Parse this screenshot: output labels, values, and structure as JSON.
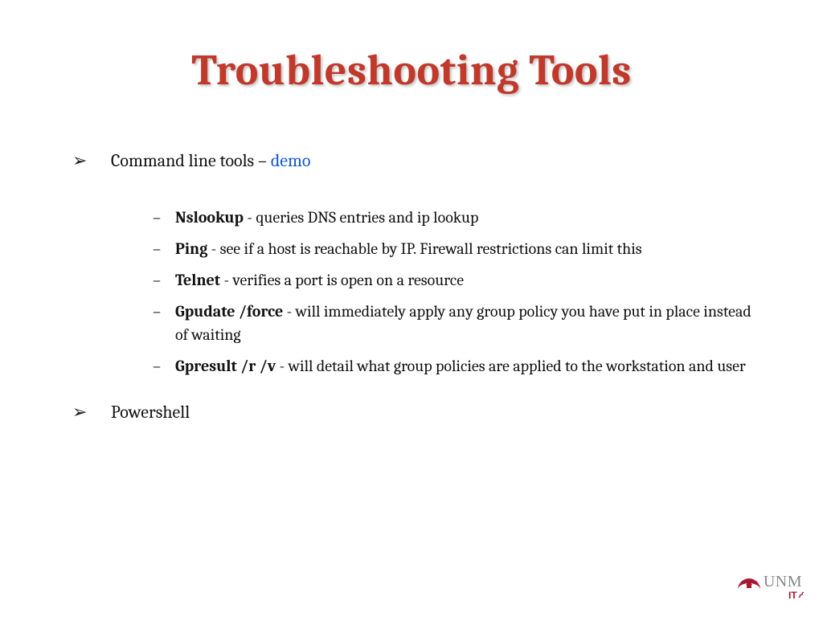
{
  "title": "Troubleshooting Tools",
  "bullets": {
    "b1_prefix": "Command line tools – ",
    "b1_link": "demo",
    "sub": [
      {
        "bold": "Nslookup",
        "rest": " - queries DNS entries and ip lookup"
      },
      {
        "bold": "Ping",
        "rest": " - see if a host is reachable by IP. Firewall restrictions can limit this"
      },
      {
        "bold": "Telnet",
        "rest": " - verifies a port is open on a resource"
      },
      {
        "bold": "Gpudate /force",
        "rest": " - will immediately apply any group policy you have put in place instead of waiting"
      },
      {
        "bold": "Gpresult /r /v",
        "rest": " - will detail what group policies are applied to the workstation and user"
      }
    ],
    "b2": "Powershell"
  },
  "footer": {
    "org": "UNM",
    "dept": "IT"
  }
}
